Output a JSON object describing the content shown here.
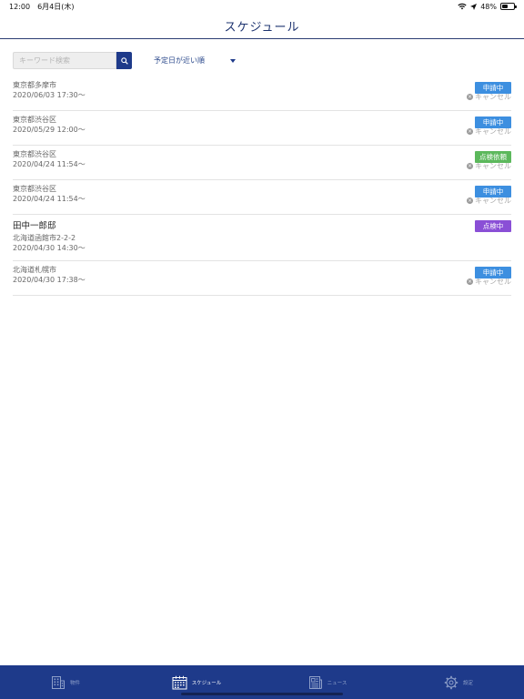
{
  "status": {
    "time": "12:00",
    "date": "6月4日(木)",
    "battery": "48%",
    "battery_level": 0.48
  },
  "header": {
    "title": "スケジュール"
  },
  "search": {
    "placeholder": "キーワード検索",
    "sort_label": "予定日が近い順"
  },
  "schedule": [
    {
      "owner": "",
      "address": "東京都多摩市",
      "datetime": "2020/06/03 17:30〜",
      "status": "申請中",
      "status_color": "#3d8fe0",
      "cancel": "キャンセル"
    },
    {
      "owner": "",
      "address": "東京都渋谷区",
      "datetime": "2020/05/29 12:00〜",
      "status": "申請中",
      "status_color": "#3d8fe0",
      "cancel": "キャンセル"
    },
    {
      "owner": "",
      "address": "東京都渋谷区",
      "datetime": "2020/04/24 11:54〜",
      "status": "点検依頼",
      "status_color": "#5cb85c",
      "cancel": "キャンセル"
    },
    {
      "owner": "",
      "address": "東京都渋谷区",
      "datetime": "2020/04/24 11:54〜",
      "status": "申請中",
      "status_color": "#3d8fe0",
      "cancel": "キャンセル"
    },
    {
      "owner": "田中一郎邸",
      "address": "北海道函館市2-2-2",
      "datetime": "2020/04/30 14:30〜",
      "status": "点検中",
      "status_color": "#8a4fd6",
      "cancel": ""
    },
    {
      "owner": "",
      "address": "北海道札幌市",
      "datetime": "2020/04/30 17:38〜",
      "status": "申請中",
      "status_color": "#3d8fe0",
      "cancel": "キャンセル"
    }
  ],
  "tabbar": {
    "tabs": [
      {
        "label": "物件",
        "icon": "building-icon",
        "active": false
      },
      {
        "label": "スケジュール",
        "icon": "calendar-icon",
        "active": true
      },
      {
        "label": "ニュース",
        "icon": "newspaper-icon",
        "active": false
      },
      {
        "label": "設定",
        "icon": "gear-icon",
        "active": false
      }
    ]
  },
  "colors": {
    "primary": "#1e3a8a",
    "applying": "#3d8fe0",
    "inspection_request": "#5cb85c",
    "inspecting": "#8a4fd6"
  }
}
